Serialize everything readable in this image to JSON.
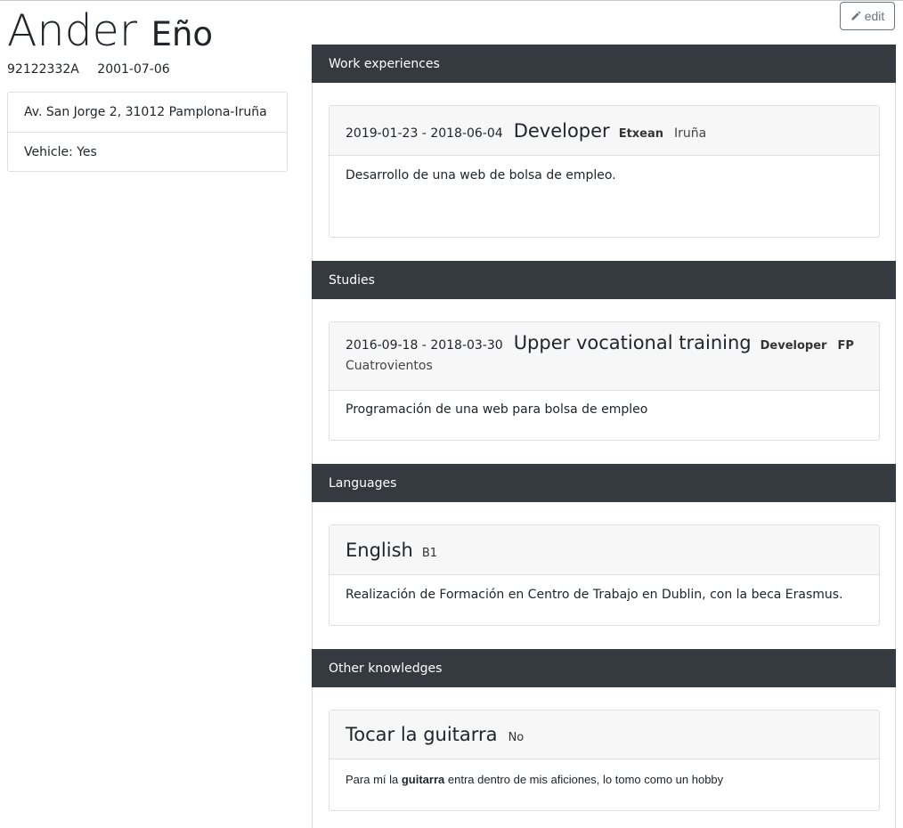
{
  "toolbar": {
    "edit_label": "edit",
    "edit_icon": "pencil-icon"
  },
  "profile": {
    "first_name": "Ander",
    "last_name": "Eño",
    "dni": "92122332A",
    "birthdate": "2001-07-06",
    "address": "Av. San Jorge 2, 31012 Pamplona-Iruña",
    "vehicle": "Vehicle: Yes"
  },
  "sections": {
    "work": {
      "heading": "Work experiences",
      "items": [
        {
          "dates": "2019-01-23 - 2018-06-04",
          "title": "Developer",
          "company": "Etxean",
          "location": "Iruña",
          "description": "Desarrollo de una web de bolsa de empleo."
        }
      ]
    },
    "studies": {
      "heading": "Studies",
      "items": [
        {
          "dates": "2016-09-18 - 2018-03-30",
          "title": "Upper vocational training",
          "field": "Developer",
          "type": "FP",
          "center": "Cuatrovientos",
          "description": "Programación de una web para bolsa de empleo"
        }
      ]
    },
    "languages": {
      "heading": "Languages",
      "items": [
        {
          "name": "English",
          "level": "B1",
          "description": "Realización de Formación en Centro de Trabajo en Dublin, con la beca Erasmus."
        }
      ]
    },
    "other": {
      "heading": "Other knowledges",
      "items": [
        {
          "name": "Tocar la guitarra",
          "certified": "No",
          "description_pre": "Para mí la ",
          "description_bold": "guitarra",
          "description_post": " entra dentro de mis aficiones, lo tomo como un hobby"
        }
      ]
    }
  }
}
